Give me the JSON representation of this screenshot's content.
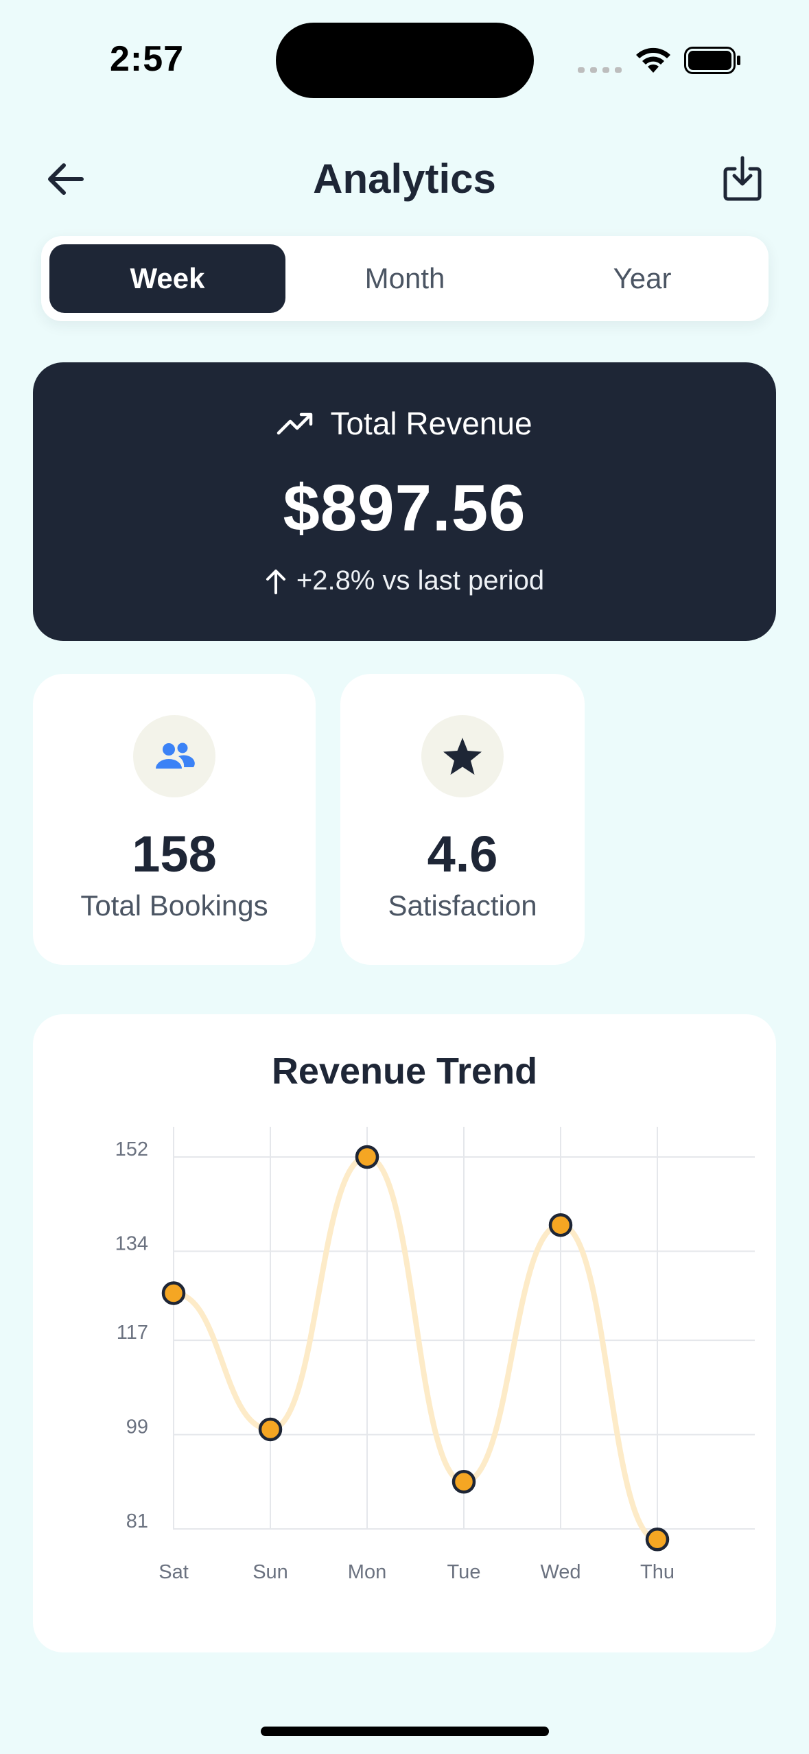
{
  "status_bar": {
    "time": "2:57"
  },
  "header": {
    "title": "Analytics",
    "back_icon": "arrow-left-icon",
    "export_icon": "download-icon"
  },
  "period_tabs": [
    {
      "label": "Week",
      "active": true
    },
    {
      "label": "Month",
      "active": false
    },
    {
      "label": "Year",
      "active": false
    }
  ],
  "revenue": {
    "label": "Total Revenue",
    "amount": "$897.56",
    "change": "+2.8% vs last period",
    "icon": "trending-up-icon"
  },
  "stats": {
    "bookings": {
      "value": "158",
      "label": "Total Bookings",
      "icon": "users-icon",
      "icon_color": "#3b82f6"
    },
    "satisfaction": {
      "value": "4.6",
      "label": "Satisfaction",
      "icon": "star-icon"
    }
  },
  "chart_data": {
    "type": "line",
    "title": "Revenue Trend",
    "categories": [
      "Sat",
      "Sun",
      "Mon",
      "Tue",
      "Wed",
      "Thu"
    ],
    "values": [
      126,
      100,
      152,
      90,
      139,
      79
    ],
    "y_ticks": [
      "152",
      "134",
      "117",
      "99",
      "81"
    ],
    "ylim": [
      81,
      152
    ],
    "grid": true,
    "line_color": "#fdebc8",
    "point_color": "#f5a623"
  }
}
